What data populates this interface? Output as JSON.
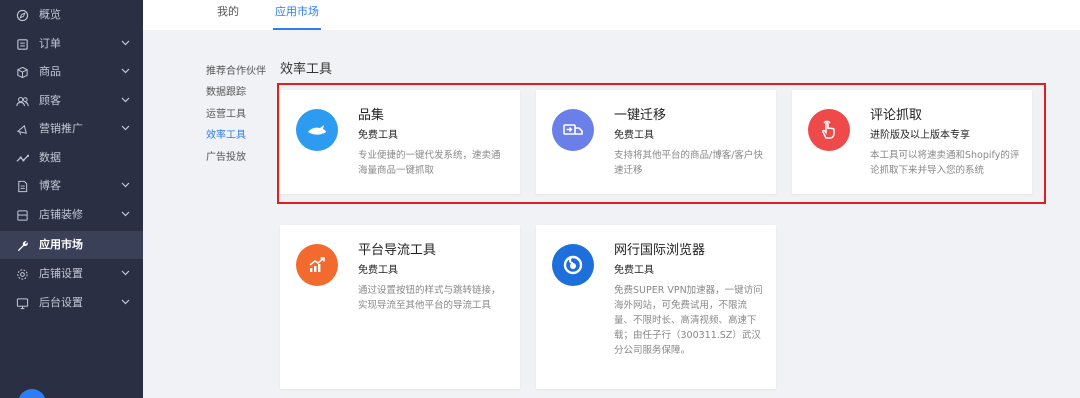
{
  "sidebar": {
    "items": [
      {
        "label": "概览",
        "icon": "compass-icon",
        "chevron": false
      },
      {
        "label": "订单",
        "icon": "order-icon",
        "chevron": true
      },
      {
        "label": "商品",
        "icon": "box-icon",
        "chevron": true
      },
      {
        "label": "顾客",
        "icon": "users-icon",
        "chevron": true
      },
      {
        "label": "营销推广",
        "icon": "megaphone-icon",
        "chevron": true
      },
      {
        "label": "数据",
        "icon": "trend-icon",
        "chevron": false
      },
      {
        "label": "博客",
        "icon": "document-icon",
        "chevron": true
      },
      {
        "label": "店铺装修",
        "icon": "layout-icon",
        "chevron": true
      },
      {
        "label": "应用市场",
        "icon": "wrench-icon",
        "chevron": false,
        "active": true
      },
      {
        "label": "店铺设置",
        "icon": "gear-icon",
        "chevron": true
      },
      {
        "label": "后台设置",
        "icon": "monitor-icon",
        "chevron": true
      }
    ]
  },
  "tabs": {
    "mine": "我的",
    "market": "应用市场"
  },
  "categories": {
    "items": [
      {
        "label": "推荐合作伙伴"
      },
      {
        "label": "数据跟踪"
      },
      {
        "label": "运营工具"
      },
      {
        "label": "效率工具",
        "active": true
      },
      {
        "label": "广告投放"
      }
    ]
  },
  "section": {
    "title": "效率工具"
  },
  "cards": [
    {
      "title": "品集",
      "subtitle": "免费工具",
      "description": "专业便捷的一键代发系统，速卖通海量商品一键抓取",
      "icon": "whale-icon",
      "color": "#2d9cf0"
    },
    {
      "title": "一键迁移",
      "subtitle": "免费工具",
      "description": "支持将其他平台的商品/博客/客户快速迁移",
      "icon": "truck-icon",
      "color": "#6b7fe8"
    },
    {
      "title": "评论抓取",
      "subtitle": "进阶版及以上版本专享",
      "description": "本工具可以将速卖通和Shopify的评论抓取下来并导入您的系统",
      "icon": "hand-icon",
      "color": "#ee4a4a"
    },
    {
      "title": "平台导流工具",
      "subtitle": "免费工具",
      "description": "通过设置按钮的样式与跳转链接，实现导流至其他平台的导流工具",
      "icon": "growth-chart-icon",
      "color": "#f26a2e"
    },
    {
      "title": "网行国际浏览器",
      "subtitle": "免费工具",
      "description": "免费SUPER VPN加速器，一键访问海外网站，可免费试用，不限流量、不限时长、高清视频、高速下载；由任子行（300311.SZ）武汉分公司服务保障。",
      "icon": "browser-logo-icon",
      "color": "#1e6fdc"
    }
  ]
}
